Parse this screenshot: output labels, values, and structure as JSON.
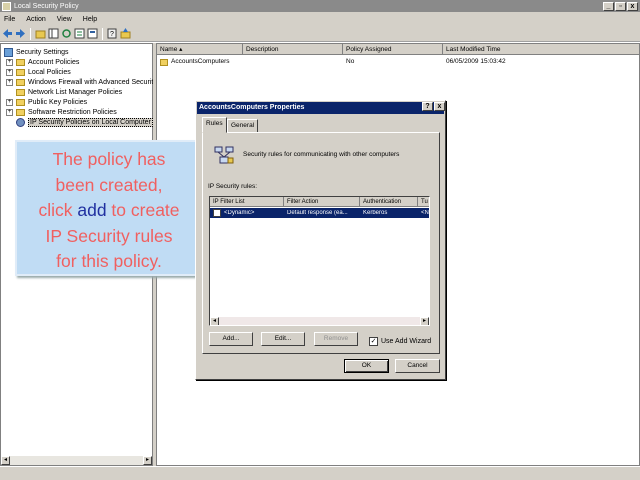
{
  "window": {
    "title": "Local Security Policy",
    "minimize": "_",
    "maximize": "▫",
    "close": "x"
  },
  "menu": [
    "File",
    "Action",
    "View",
    "Help"
  ],
  "tree": {
    "root": "Security Settings",
    "items": [
      {
        "label": "Account Policies",
        "expandable": true
      },
      {
        "label": "Local Policies",
        "expandable": true
      },
      {
        "label": "Windows Firewall with Advanced Security",
        "expandable": true
      },
      {
        "label": "Network List Manager Policies",
        "expandable": false
      },
      {
        "label": "Public Key Policies",
        "expandable": true
      },
      {
        "label": "Software Restriction Policies",
        "expandable": true
      },
      {
        "label": "IP Security Policies on Local Computer",
        "expandable": false,
        "selected": true
      }
    ]
  },
  "list": {
    "columns": [
      "Name",
      "Description",
      "Policy Assigned",
      "Last Modified Time"
    ],
    "rows": [
      {
        "name": "AccountsComputers",
        "description": "",
        "assigned": "No",
        "modified": "06/05/2009 15:03:42"
      }
    ]
  },
  "callout": {
    "line1": "The policy has",
    "line2": "been created,",
    "line3_pre": "click ",
    "line3_hl": "add",
    "line3_post": " to create",
    "line4": "IP Security rules",
    "line5": "for this policy."
  },
  "dialog": {
    "title": "AccountsComputers Properties",
    "help_btn": "?",
    "close_btn": "x",
    "tabs": [
      "Rules",
      "General"
    ],
    "active_tab": "Rules",
    "description": "Security rules for communicating with other computers",
    "group_label": "IP Security rules:",
    "rule_columns": [
      "IP Filter List",
      "Filter Action",
      "Authentication",
      "Tu"
    ],
    "rules": [
      {
        "checked": false,
        "filter_list": "<Dynamic>",
        "filter_action": "Default response (ea...",
        "authentication": "Kerberos",
        "tunnel": "<N"
      }
    ],
    "buttons": {
      "add": "Add...",
      "edit": "Edit...",
      "remove": "Remove",
      "ok": "OK",
      "cancel": "Cancel"
    },
    "use_add_wizard": {
      "label": "Use Add Wizard",
      "checked": true,
      "mark": "✓"
    }
  },
  "colors": {
    "title_active": "#0a246a",
    "callout_bg": "#c0dcf4",
    "callout_text": "#f06060",
    "callout_highlight": "#2030a0"
  }
}
